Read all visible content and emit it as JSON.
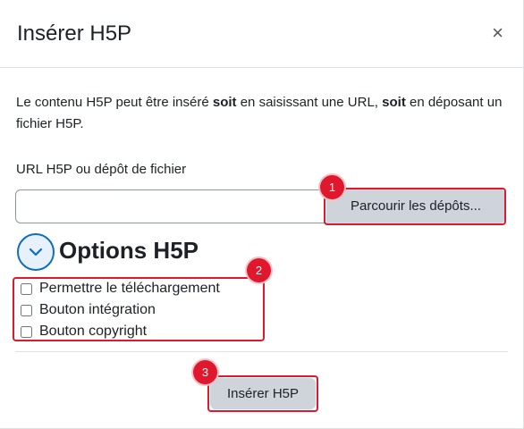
{
  "dialog": {
    "title": "Insérer H5P",
    "close_glyph": "×",
    "close_icon": "close-icon"
  },
  "intro": {
    "part1": "Le contenu H5P peut être inséré ",
    "bold1": "soit",
    "part2": " en saisissant une URL, ",
    "bold2": "soit",
    "part3": " en déposant un fichier H5P."
  },
  "url_field": {
    "label": "URL H5P ou dépôt de fichier",
    "value": "",
    "placeholder": "",
    "browse_label": "Parcourir les dépôts..."
  },
  "options": {
    "title": "Options H5P",
    "toggle_icon": "chevron-down-icon",
    "items": [
      {
        "label": "Permettre le téléchargement",
        "checked": false
      },
      {
        "label": "Bouton intégration",
        "checked": false
      },
      {
        "label": "Bouton copyright",
        "checked": false
      }
    ]
  },
  "footer": {
    "submit_label": "Insérer H5P"
  },
  "annotations": {
    "badges": [
      "1",
      "2",
      "3"
    ],
    "highlight_color": "#e0182d"
  },
  "colors": {
    "accent": "#0f6cbf",
    "button_bg": "#ced4da"
  }
}
